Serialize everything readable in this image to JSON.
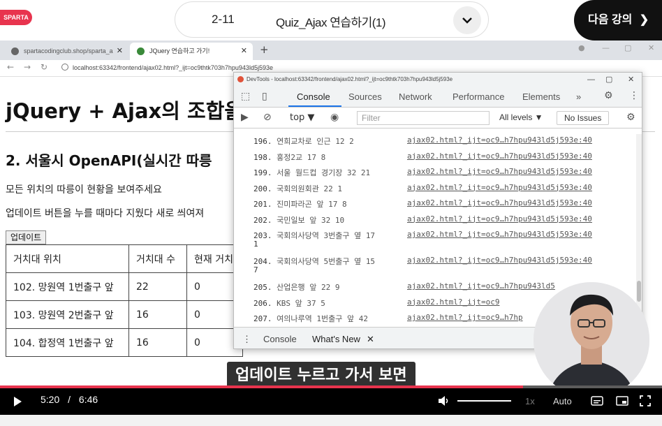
{
  "lecture": {
    "logo_text": "SPARTA",
    "lesson_number": "2-11",
    "lesson_title": "Quiz_Ajax 연습하기(1)",
    "next_button": "다음 강의"
  },
  "browser": {
    "tabs": [
      {
        "label": "spartacodingclub.shop/sparta_a"
      },
      {
        "label": "JQuery 연습하고 가기!"
      }
    ],
    "url": "localhost:63342/frontend/ajax02.html?_ijt=oc9thtk703h7hpu943ld5j593e"
  },
  "page": {
    "heading": "jQuery + Ajax의 조합을",
    "subheading": "2. 서울시 OpenAPI(실시간 따릉",
    "description1": "모든 위치의 따릉이 현황을 보여주세요",
    "description2": "업데이트 버튼을 누를 때마다 지웠다 새로 씌여져",
    "update_button": "업데이트",
    "table": {
      "headers": [
        "거치대 위치",
        "거치대 수",
        "현재 거치"
      ],
      "rows": [
        [
          "102. 망원역 1번출구 앞",
          "22",
          "0"
        ],
        [
          "103. 망원역 2번출구 앞",
          "16",
          "0"
        ],
        [
          "104. 합정역 1번출구 앞",
          "16",
          "0"
        ]
      ]
    }
  },
  "devtools": {
    "title": "DevTools - localhost:63342/frontend/ajax02.html?_ijt=oc9thtk703h7hpu943ld5j593e",
    "tabs": [
      "Console",
      "Sources",
      "Network",
      "Performance",
      "Elements",
      "»"
    ],
    "context": "top ▼",
    "filter_placeholder": "Filter",
    "levels": "All levels ▼",
    "issues": "No Issues",
    "logs": [
      {
        "num": "196.",
        "text": "연희교차로 인근 12 2",
        "cont": "",
        "src": "ajax02.html?_ijt=oc9…h7hpu943ld5j593e:40"
      },
      {
        "num": "198.",
        "text": "홍정2교 17 8",
        "cont": "",
        "src": "ajax02.html?_ijt=oc9…h7hpu943ld5j593e:40"
      },
      {
        "num": "199.",
        "text": "서울 월드컵 경기장 32 21",
        "cont": "",
        "src": "ajax02.html?_ijt=oc9…h7hpu943ld5j593e:40"
      },
      {
        "num": "200.",
        "text": "국회의원회관 22 1",
        "cont": "",
        "src": "ajax02.html?_ijt=oc9…h7hpu943ld5j593e:40"
      },
      {
        "num": "201.",
        "text": "진미파라곤 앞 17 8",
        "cont": "",
        "src": "ajax02.html?_ijt=oc9…h7hpu943ld5j593e:40"
      },
      {
        "num": "202.",
        "text": "국민일보 앞 32 10",
        "cont": "",
        "src": "ajax02.html?_ijt=oc9…h7hpu943ld5j593e:40"
      },
      {
        "num": "203.",
        "text": "국회의사당역 3번출구 옆 17",
        "cont": "1",
        "src": "ajax02.html?_ijt=oc9…h7hpu943ld5j593e:40"
      },
      {
        "num": "204.",
        "text": "국회의사당역 5번출구 옆 15",
        "cont": "7",
        "src": "ajax02.html?_ijt=oc9…h7hpu943ld5j593e:40"
      },
      {
        "num": "205.",
        "text": "산업은행 앞 22 9",
        "cont": "",
        "src": "ajax02.html?_ijt=oc9…h7hpu943ld5"
      },
      {
        "num": "206.",
        "text": "KBS 앞 37 5",
        "cont": "",
        "src": "ajax02.html?_ijt=oc9"
      },
      {
        "num": "207.",
        "text": "여의나루역 1번출구 앞 42",
        "cont": "",
        "src": "ajax02.html?_ijt=oc9…h7hp"
      }
    ],
    "drawer_tabs": [
      "Console",
      "What's New"
    ]
  },
  "subtitle": "업데이트 누르고 가서 보면",
  "player": {
    "current_time": "5:20",
    "separator": "/",
    "duration": "6:46",
    "progress": 0.79,
    "speed": "1x",
    "quality": "Auto"
  },
  "colors": {
    "brand": "#e8344e",
    "link_blue": "#1a73e8"
  }
}
